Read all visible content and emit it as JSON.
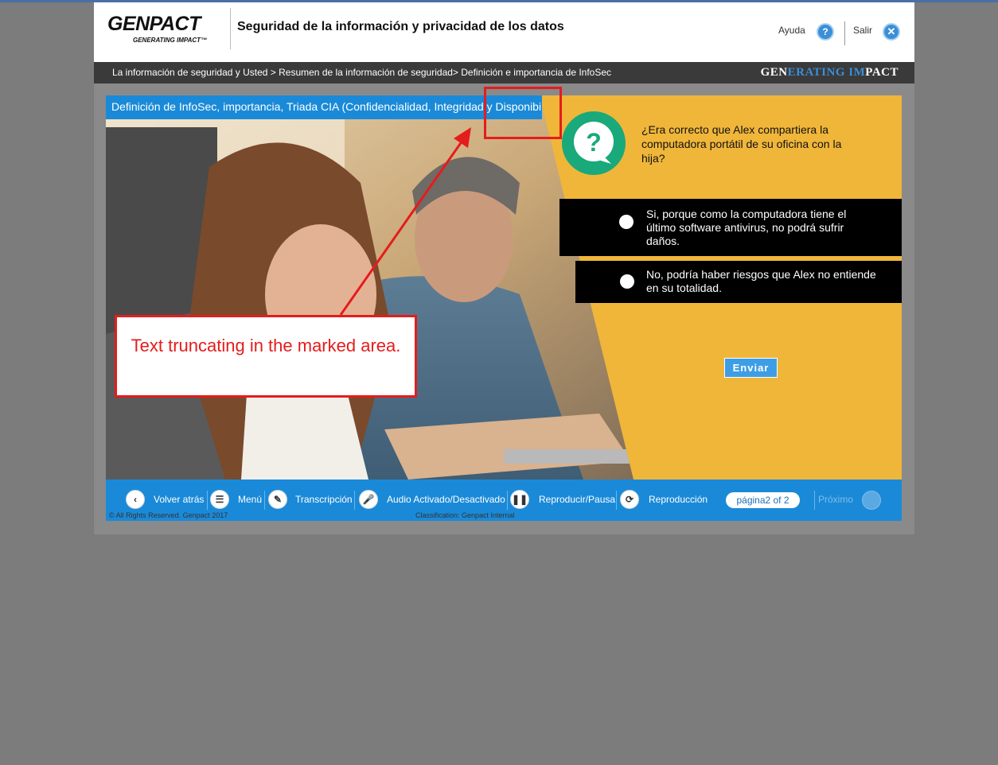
{
  "header": {
    "logo_name": "GENPACT",
    "logo_tag": "GENERATING IMPACT™",
    "course_title": "Seguridad de la información y privacidad de los datos",
    "help_label": "Ayuda",
    "help_icon": "?",
    "exit_label": "Salir",
    "exit_icon": "✕"
  },
  "breadcrumb": {
    "text": "La información de seguridad y Usted > Resumen de la información de seguridad> Definición e importancia de InfoSec",
    "brand_part1": "GEN",
    "brand_part2": "ERATING ",
    "brand_part3": "IM",
    "brand_part4": "PACT"
  },
  "slide": {
    "title": "Definición de InfoSec, importancia, Triada CIA (Confidencialidad, Integridad y Disponibilidad)",
    "question": "¿Era correcto que Alex compartiera la computadora portátil de su oficina con la hija?",
    "options": [
      {
        "text": "Si, porque como la computadora tiene el último software antivirus, no podrá sufrir daños."
      },
      {
        "text": "No, podría haber riesgos que Alex no entiende en su totalidad."
      }
    ],
    "submit_label": "Enviar"
  },
  "navbar": {
    "items": [
      {
        "label": "Volver atrás",
        "icon": "back-icon"
      },
      {
        "label": "Menú",
        "icon": "menu-icon"
      },
      {
        "label": "Transcripción",
        "icon": "transcript-icon"
      },
      {
        "label": "Audio Activado/Desactivado",
        "icon": "microphone-icon"
      },
      {
        "label": "Reproducir/Pausa",
        "icon": "pause-icon"
      },
      {
        "label": "Reproducción",
        "icon": "replay-icon"
      }
    ],
    "page_indicator": "página2 of 2",
    "next_label": "Próximo",
    "copyright": "© All Rights Reserved. Genpact 2017",
    "classification": "Classification: Genpact Internal"
  },
  "annotation": {
    "callout_text": "Text truncating in the marked area."
  },
  "colors": {
    "accent_blue": "#1a8ad8",
    "panel_yellow": "#f0b63a",
    "annotation_red": "#e51c1c",
    "question_icon_green": "#1aa97a"
  }
}
